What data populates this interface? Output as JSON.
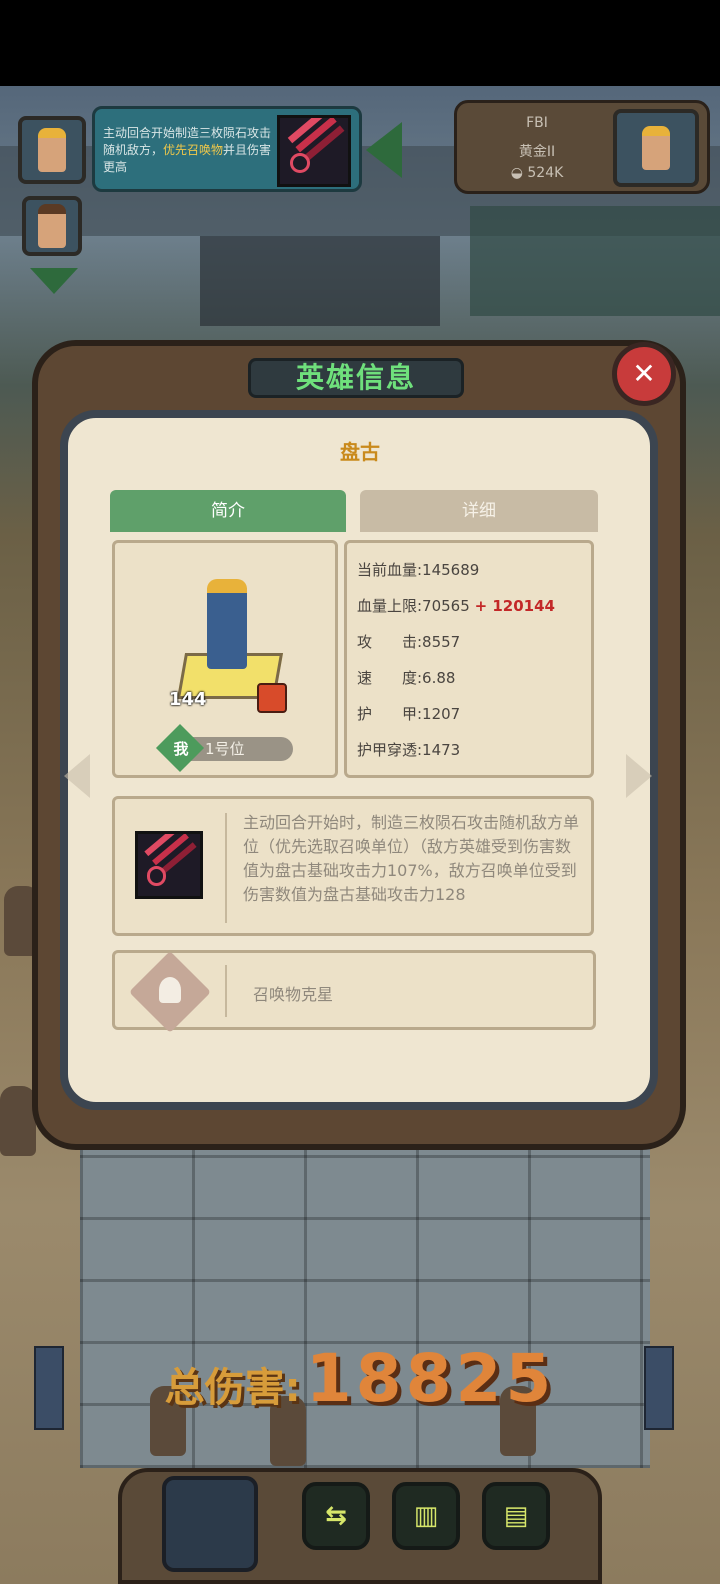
{
  "hud": {
    "skill_tip": {
      "text_normal": "主动回合开始制造三枚陨石攻击随机敌方，",
      "text_highlight": "优先召唤物",
      "text_tail": "并且伤害更高"
    },
    "opponent": {
      "name": "FBI",
      "rank": "黄金II",
      "power": "524K"
    }
  },
  "modal": {
    "title": "英雄信息",
    "close_icon": "✕",
    "hero_name": "盘古",
    "tabs": [
      "简介",
      "详细"
    ],
    "portrait": {
      "level": "144",
      "me_badge": "我",
      "position": "1号位"
    },
    "stats": {
      "current_hp": "当前血量:145689",
      "max_hp": "血量上限:70565",
      "max_hp_bonus": "+ 120144",
      "attack": "攻　　击:8557",
      "speed": "速　　度:6.88",
      "armor": "护　　甲:1207",
      "armor_pen": "护甲穿透:1473"
    },
    "skill_description": "主动回合开始时，制造三枚陨石攻击随机敌方单位（优先选取召唤单位）（敌方英雄受到伤害数值为盘古基础攻击力107%，敌方召唤单位受到伤害数值为盘古基础攻击力128",
    "summon": "召唤物克星"
  },
  "battle": {
    "total_damage_label": "总伤害:",
    "total_damage_value": "18825"
  },
  "bottom_bar": {
    "buttons": [
      "⇆",
      "▥",
      "▤"
    ]
  },
  "colors": {
    "title_green": "#6fe07c",
    "tab_active": "#5fa06a",
    "bonus_red": "#c32828",
    "damage_orange": "#e0853a"
  }
}
